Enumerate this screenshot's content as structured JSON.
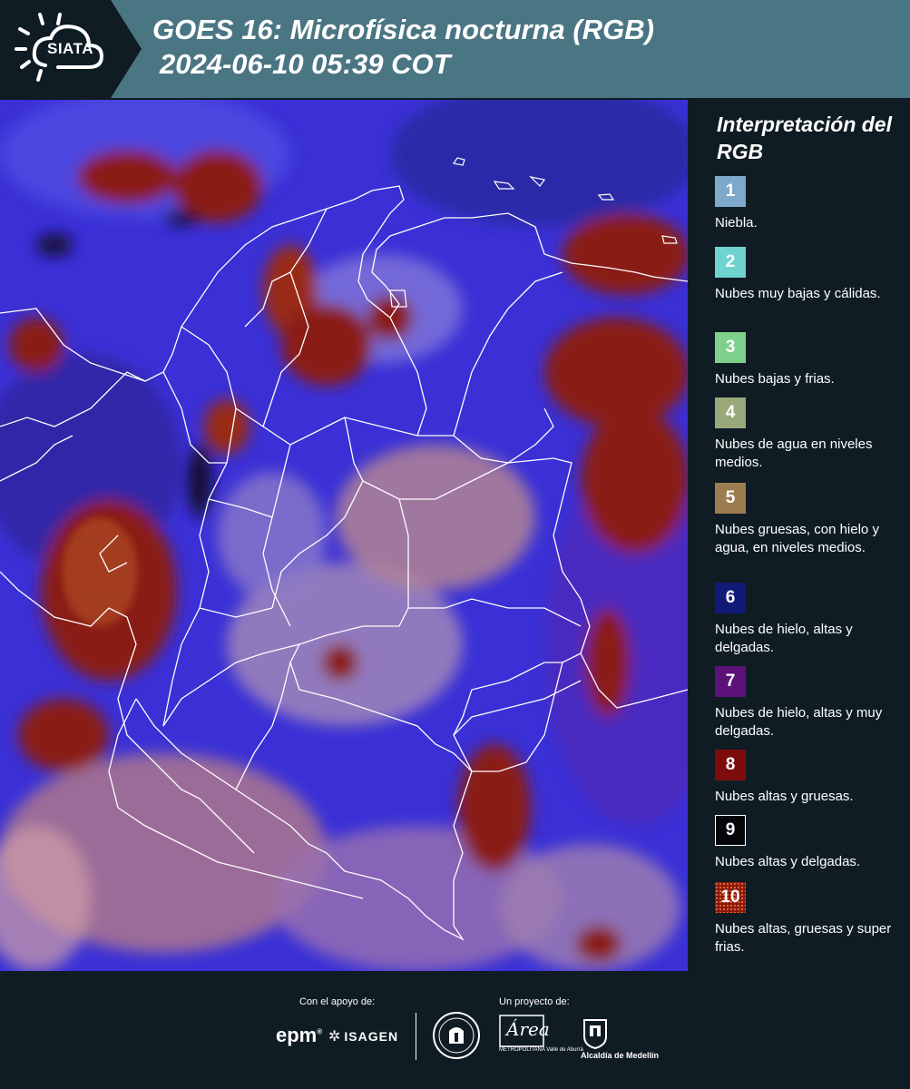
{
  "header": {
    "logo_text": "SIATA",
    "title_line1": "GOES 16: Microfísica nocturna (RGB)",
    "title_line2": "2024-06-10 05:39 COT"
  },
  "legend": {
    "title": "Interpretación del RGB",
    "items": [
      {
        "num": "1",
        "label": "Niebla.",
        "color": "#7ea9cc"
      },
      {
        "num": "2",
        "label": "Nubes muy bajas y cálidas.",
        "color": "#6fd3cf"
      },
      {
        "num": "3",
        "label": "Nubes bajas y frias.",
        "color": "#7fd08b"
      },
      {
        "num": "4",
        "label": "Nubes de agua en niveles medios.",
        "color": "#9aa97a"
      },
      {
        "num": "5",
        "label": "Nubes gruesas, con hielo y agua, en niveles medios.",
        "color": "#9c7d4f"
      },
      {
        "num": "6",
        "label": "Nubes de hielo, altas y delgadas.",
        "color": "#121a78"
      },
      {
        "num": "7",
        "label": "Nubes de hielo, altas y muy delgadas.",
        "color": "#5c1278"
      },
      {
        "num": "8",
        "label": "Nubes altas y gruesas.",
        "color": "#7d0d0d"
      },
      {
        "num": "9",
        "label": "Nubes altas y delgadas.",
        "color": "#05060a"
      },
      {
        "num": "10",
        "label": "Nubes altas, gruesas y super frias.",
        "color": "#8a1a10"
      }
    ]
  },
  "footer": {
    "support_label": "Con el apoyo de:",
    "project_label": "Un proyecto de:",
    "epm": "epm",
    "isagen": "ISAGEN",
    "metro_word": "Área",
    "metro_sub": "METROPOLITANA Valle de Aburrá",
    "alcaldia": "Alcaldía de Medellín"
  },
  "colors": {
    "header_bg": "#4a7583",
    "panel_bg": "#0f1c24",
    "map_base": "#3a34d8",
    "cloud_high_thick": "#8a1c12",
    "cloud_mid": "#c08a8a"
  }
}
